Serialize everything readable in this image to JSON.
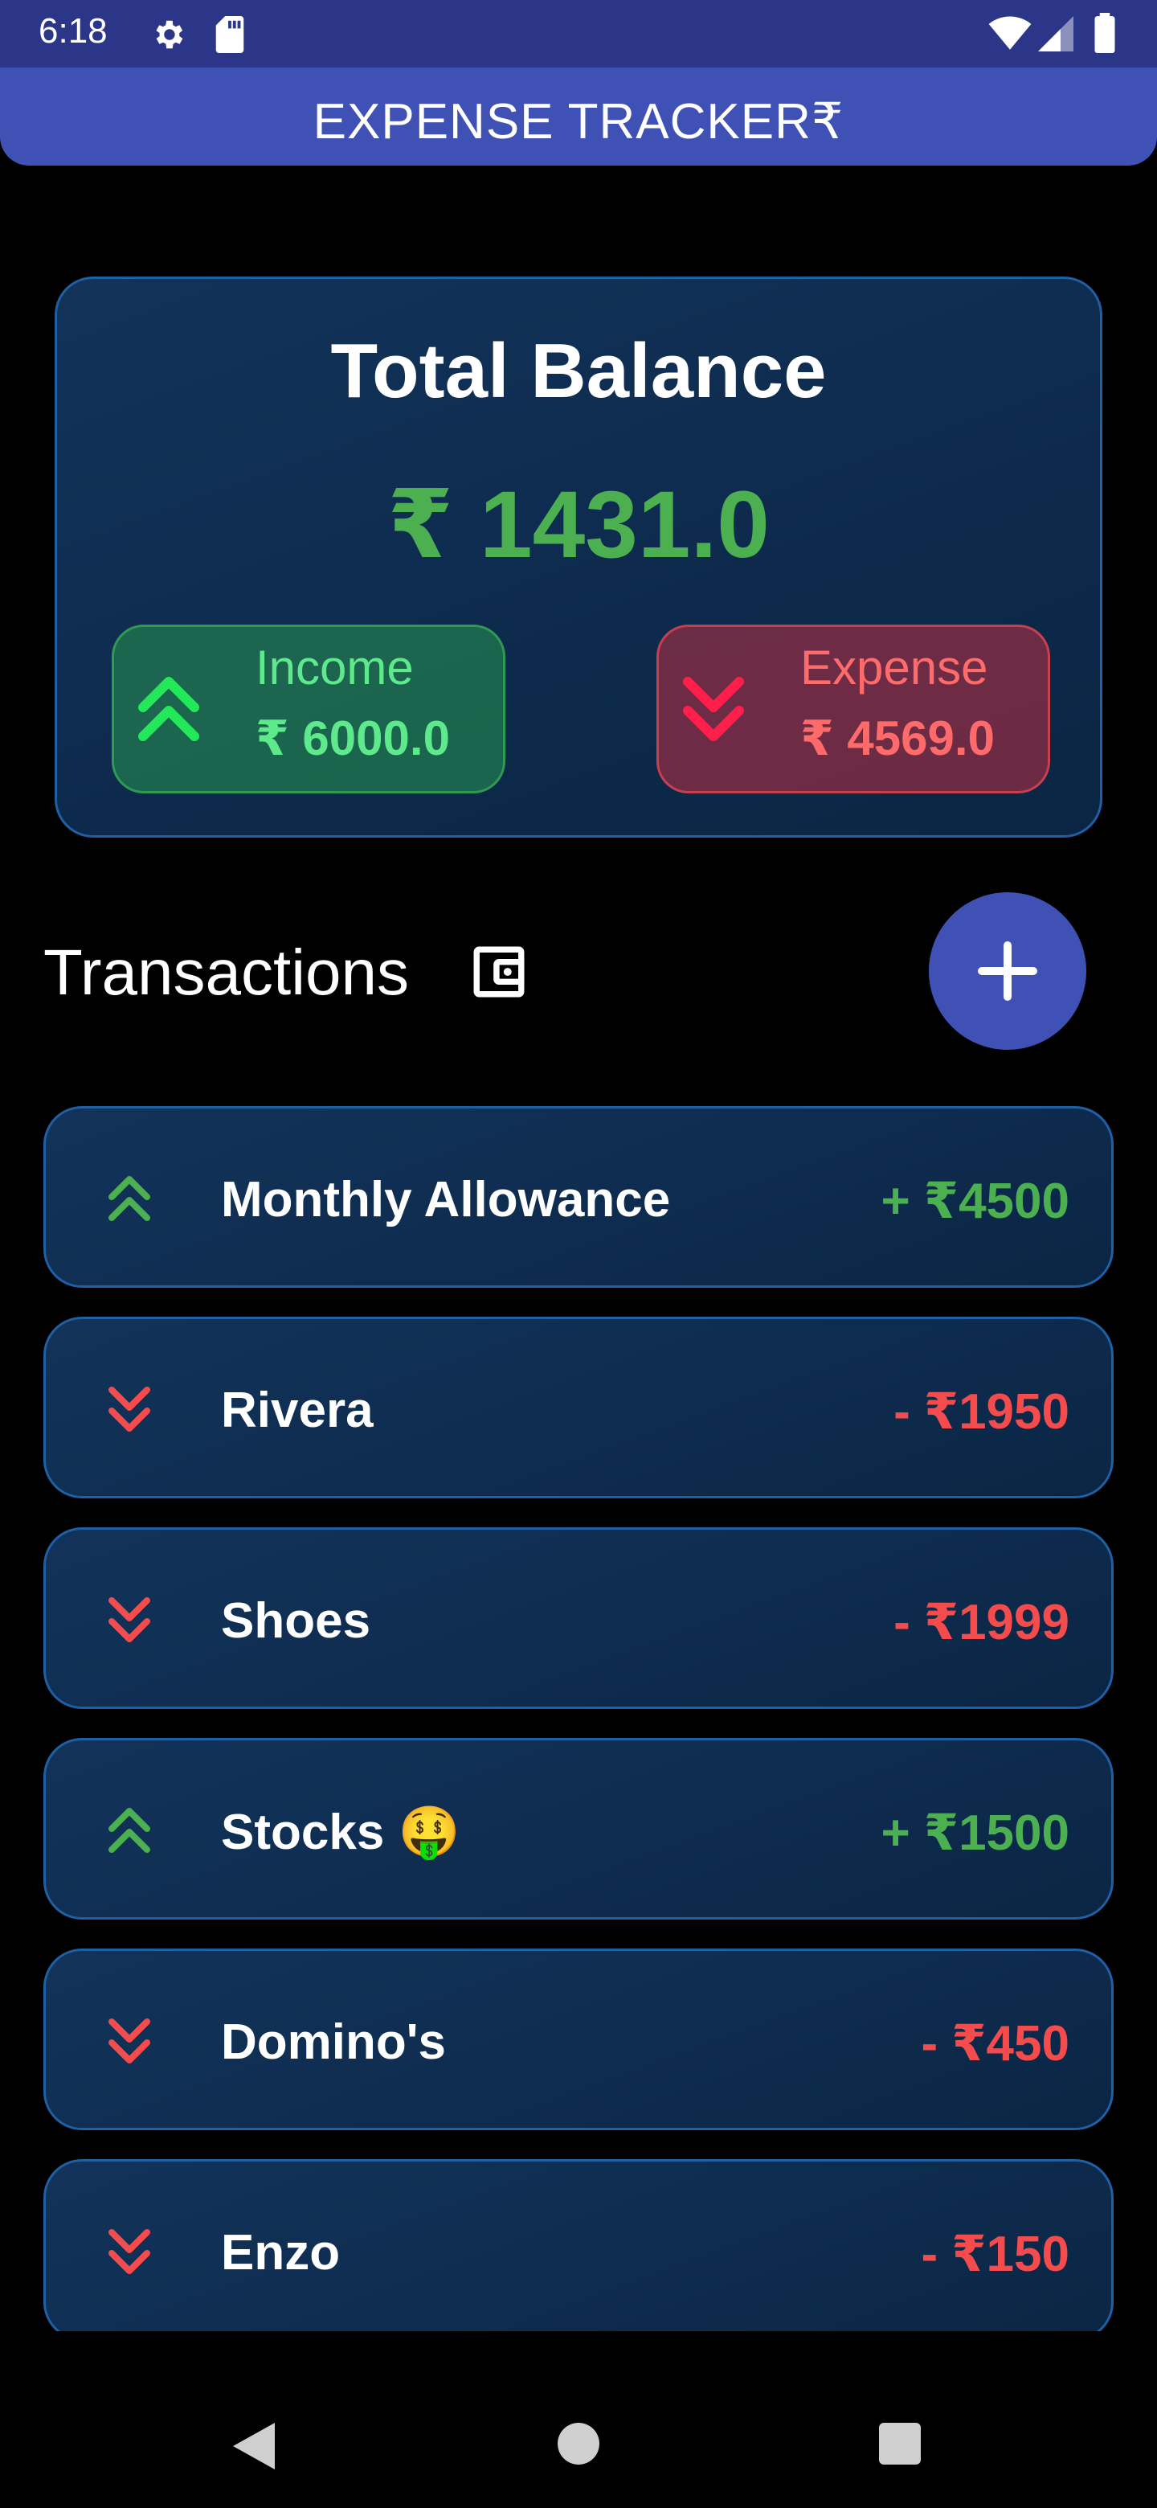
{
  "status_bar": {
    "time": "6:18",
    "icons": [
      "gear-icon",
      "sd-card-icon",
      "wifi-icon",
      "signal-icon",
      "battery-icon"
    ]
  },
  "app_bar": {
    "title": "EXPENSE TRACKER₹"
  },
  "balance": {
    "title": "Total Balance",
    "amount": "₹ 1431.0",
    "income": {
      "label": "Income",
      "value": "₹ 6000.0",
      "icon": "double-chevron-up-icon"
    },
    "expense": {
      "label": "Expense",
      "value": "₹ 4569.0",
      "icon": "double-chevron-down-icon"
    }
  },
  "transactions": {
    "title": "Transactions",
    "wallet_icon": "wallet-icon",
    "add_icon": "plus-icon",
    "items": [
      {
        "name": "Monthly Allowance",
        "amount": "+ ₹4500",
        "type": "income"
      },
      {
        "name": "Rivera",
        "amount": "- ₹1950",
        "type": "expense"
      },
      {
        "name": "Shoes",
        "amount": "- ₹1999",
        "type": "expense"
      },
      {
        "name": "Stocks 🤑",
        "amount": "+ ₹1500",
        "type": "income"
      },
      {
        "name": "Domino's",
        "amount": "- ₹450",
        "type": "expense"
      },
      {
        "name": "Enzo",
        "amount": "- ₹150",
        "type": "expense"
      }
    ]
  },
  "colors": {
    "status_bar": "#2c3688",
    "app_bar": "#3f51b5",
    "card_bg": "#0d2a4c",
    "card_border": "#1f5fa3",
    "income": "#4caf50",
    "expense": "#f44c4c",
    "income_pill_text": "#5eea8c",
    "expense_pill_text": "#ff6b6b"
  },
  "nav_bar": {
    "icons": [
      "back-icon",
      "home-icon",
      "recents-icon"
    ]
  }
}
